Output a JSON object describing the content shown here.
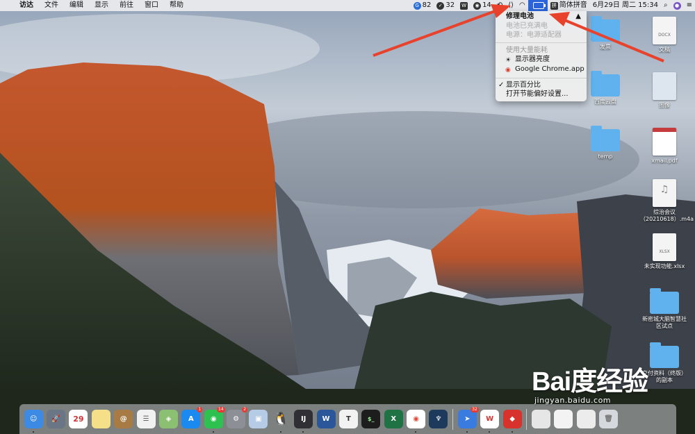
{
  "menubar": {
    "apple": "",
    "items": [
      "访达",
      "文件",
      "编辑",
      "显示",
      "前往",
      "窗口",
      "帮助"
    ],
    "status": {
      "app1_count": "82",
      "app2_count": "32",
      "wechat_count": "14",
      "battery_label": "",
      "ime_label": "简体拼音",
      "datetime": "6月29日 周二 15:34"
    }
  },
  "battery_menu": {
    "title": "修理电池",
    "line1": "电池已充满电",
    "line2": "电源：电源适配器",
    "energy_header": "使用大量能耗",
    "app1": "显示器亮度",
    "app2": "Google Chrome.app",
    "show_percent": "显示百分比",
    "open_prefs": "打开节能偏好设置..."
  },
  "desktop": {
    "icons": [
      {
        "label": "发票"
      },
      {
        "label": "文稿",
        "ext": "DOCX"
      },
      {
        "label": "百度云盘"
      },
      {
        "label": "图像"
      },
      {
        "label": "temp"
      },
      {
        "label": "xmail.pdf"
      },
      {
        "label": "综治会议（20210618）.m4a"
      },
      {
        "label": "未实现功能.xlsx",
        "ext": "XLSX"
      },
      {
        "label": "新密城大脑智慧社区试点"
      },
      {
        "label": "交付资料（终版）的副本"
      }
    ]
  },
  "dock": {
    "calendar_day": "29",
    "appstore_badge": "1",
    "wechat_badge": "14",
    "prefs_badge": "2",
    "feishu_badge": "32",
    "intellij_label": "IJ",
    "word_label": "W",
    "typora_label": "T",
    "terminal_label": "$_",
    "excel_label": "X",
    "wps_label": "W"
  },
  "watermark": {
    "logo": "Bai度经验",
    "url": "jingyan.baidu.com"
  },
  "colors": {
    "highlight": "#2b64d8",
    "arrow": "#e8412c",
    "folder": "#5fb2ee"
  }
}
